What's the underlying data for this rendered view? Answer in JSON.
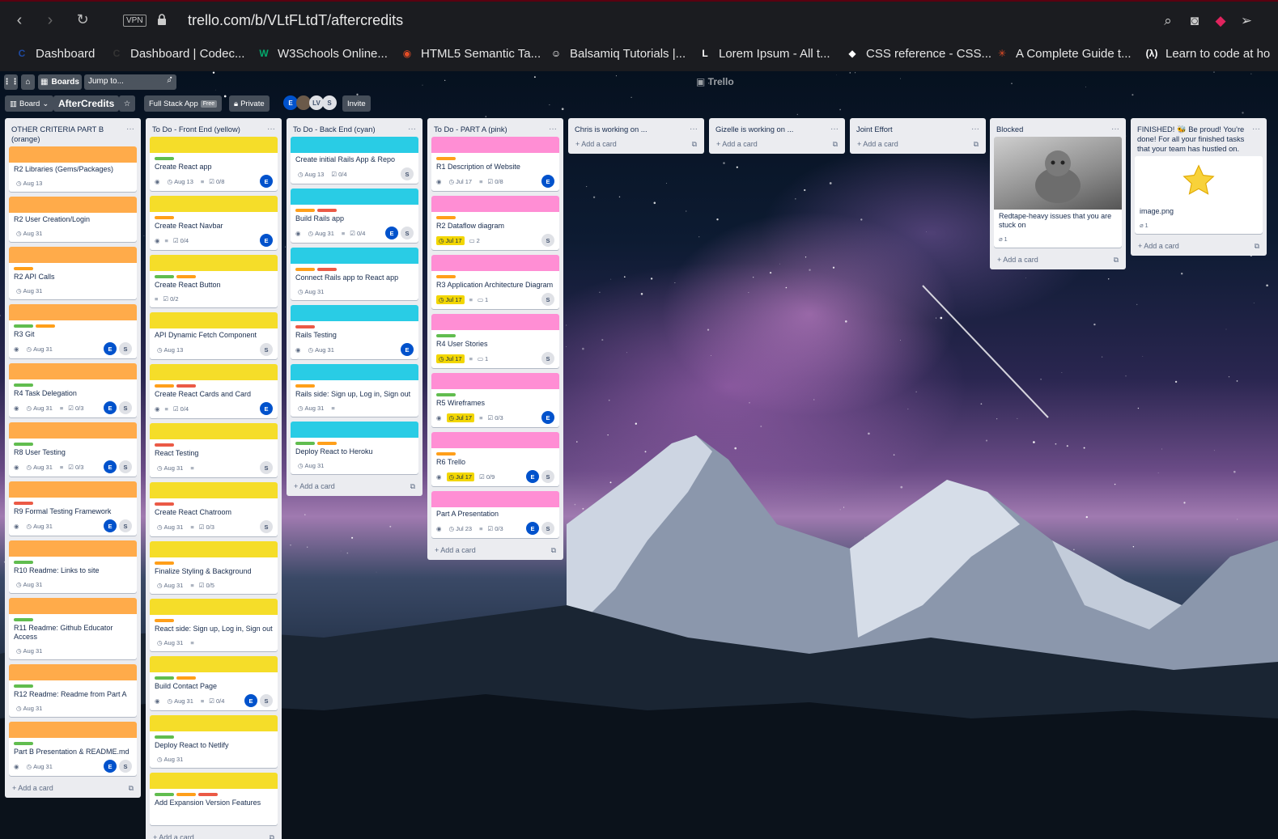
{
  "browser": {
    "url": "trello.com/b/VLtFLtdT/aftercredits",
    "vpn": "VPN"
  },
  "bookmarks": [
    {
      "label": "Dashboard",
      "icon": "codecademy-icon",
      "color": "#1f4aa0"
    },
    {
      "label": "Dashboard | Codec...",
      "icon": "codecademy-icon",
      "color": "#333"
    },
    {
      "label": "W3Schools Online...",
      "icon": "w3schools-icon",
      "color": "#04aa6d"
    },
    {
      "label": "HTML5 Semantic Ta...",
      "icon": "html-icon",
      "color": "#e44d26"
    },
    {
      "label": "Balsamiq Tutorials |...",
      "icon": "balsamiq-icon",
      "color": "#ffffff"
    },
    {
      "label": "Lorem Ipsum - All t...",
      "icon": "lorem-icon",
      "color": "#ffffff"
    },
    {
      "label": "CSS reference - CSS...",
      "icon": "css-icon",
      "color": "#ffffff"
    },
    {
      "label": "A Complete Guide t...",
      "icon": "csstricks-icon",
      "color": "#e44d26"
    },
    {
      "label": "Learn to code at ho",
      "icon": "freecodecamp-icon",
      "color": "#ffffff"
    }
  ],
  "topbar": {
    "boards": "Boards",
    "jump": "Jump to...",
    "logo": "Trello"
  },
  "header": {
    "board_btn": "Board",
    "title": "AfterCredits",
    "team": "Full Stack App",
    "team_badge": "Free",
    "privacy": "Private",
    "invite": "Invite",
    "members": [
      "E",
      "LV",
      "S"
    ]
  },
  "colors": {
    "orange": "#ffab4a",
    "yellow": "#f5dd29",
    "cyan": "#29cce5",
    "pink": "#ff8ed4",
    "green": "#61bd4f",
    "red": "#eb5a46",
    "lorange": "#ff9f1a"
  },
  "lists": [
    {
      "title": "OTHER CRITERIA PART B (orange)",
      "cover": "orange",
      "cards": [
        {
          "title": "R2 Libraries (Gems/Packages)",
          "labels": [],
          "watch": false,
          "due": "Aug 13"
        },
        {
          "title": "R2 User Creation/Login",
          "labels": [],
          "watch": false,
          "due": "Aug 31"
        },
        {
          "title": "R2 API Calls",
          "labels": [
            "lorange"
          ],
          "watch": false,
          "due": "Aug 31"
        },
        {
          "title": "R3 Git",
          "labels": [
            "green",
            "lorange"
          ],
          "watch": true,
          "due": "Aug 31",
          "avatars": [
            "E",
            "S"
          ]
        },
        {
          "title": "R4 Task Delegation",
          "labels": [
            "green"
          ],
          "watch": true,
          "due": "Aug 31",
          "desc": true,
          "check": "0/3",
          "avatars": [
            "E",
            "S"
          ]
        },
        {
          "title": "R8 User Testing",
          "labels": [
            "green"
          ],
          "watch": true,
          "due": "Aug 31",
          "desc": true,
          "check": "0/3",
          "avatars": [
            "E",
            "S"
          ]
        },
        {
          "title": "R9 Formal Testing Framework",
          "labels": [
            "red"
          ],
          "watch": true,
          "due": "Aug 31",
          "avatars": [
            "E",
            "S"
          ]
        },
        {
          "title": "R10 Readme: Links to site",
          "labels": [
            "green"
          ],
          "watch": false,
          "due": "Aug 31"
        },
        {
          "title": "R11 Readme: Github Educator Access",
          "labels": [
            "green"
          ],
          "watch": false,
          "due": "Aug 31"
        },
        {
          "title": "R12 Readme: Readme from Part A",
          "labels": [
            "green"
          ],
          "watch": false,
          "due": "Aug 31"
        },
        {
          "title": "Part B Presentation & README.md",
          "labels": [
            "green"
          ],
          "watch": true,
          "due": "Aug 31",
          "avatars": [
            "E",
            "S"
          ]
        }
      ],
      "add": "Add a card"
    },
    {
      "title": "To Do - Front End (yellow)",
      "cover": "yellow",
      "cards": [
        {
          "title": "Create React app",
          "labels": [
            "green"
          ],
          "watch": true,
          "due": "Aug 13",
          "desc": true,
          "check": "0/8",
          "avatars": [
            "E"
          ]
        },
        {
          "title": "Create React Navbar",
          "labels": [
            "lorange"
          ],
          "watch": true,
          "desc": true,
          "check": "0/4",
          "avatars": [
            "E"
          ]
        },
        {
          "title": "Create React Button",
          "labels": [
            "green",
            "lorange"
          ],
          "desc": true,
          "check": "0/2"
        },
        {
          "title": "API Dynamic Fetch Component",
          "labels": [],
          "due": "Aug 13",
          "avatars": [
            "S"
          ]
        },
        {
          "title": "Create React Cards and Card",
          "labels": [
            "lorange",
            "red"
          ],
          "watch": true,
          "desc": true,
          "check": "0/4",
          "avatars": [
            "E"
          ]
        },
        {
          "title": "React Testing",
          "labels": [
            "red"
          ],
          "due": "Aug 31",
          "desc": true,
          "avatars": [
            "S"
          ]
        },
        {
          "title": "Create React Chatroom",
          "labels": [
            "red"
          ],
          "due": "Aug 31",
          "desc": true,
          "check": "0/3",
          "avatars": [
            "S"
          ]
        },
        {
          "title": "Finalize Styling & Background",
          "labels": [
            "lorange"
          ],
          "due": "Aug 31",
          "desc": true,
          "check": "0/5"
        },
        {
          "title": "React side: Sign up, Log in, Sign out",
          "labels": [
            "lorange"
          ],
          "due": "Aug 31",
          "desc": true
        },
        {
          "title": "Build Contact Page",
          "labels": [
            "green",
            "lorange"
          ],
          "watch": true,
          "due": "Aug 31",
          "desc": true,
          "check": "0/4",
          "avatars": [
            "E",
            "S"
          ]
        },
        {
          "title": "Deploy React to Netlify",
          "labels": [
            "green"
          ],
          "due": "Aug 31"
        },
        {
          "title": "Add Expansion Version Features",
          "labels": [
            "green",
            "lorange",
            "red"
          ]
        }
      ],
      "add": "Add a card"
    },
    {
      "title": "To Do - Back End (cyan)",
      "cover": "cyan",
      "cards": [
        {
          "title": "Create initial Rails App & Repo",
          "labels": [],
          "due": "Aug 13",
          "check": "0/4",
          "avatars": [
            "S"
          ]
        },
        {
          "title": "Build Rails app",
          "labels": [
            "lorange",
            "red"
          ],
          "watch": true,
          "due": "Aug 31",
          "desc": true,
          "check": "0/4",
          "avatars": [
            "E",
            "S"
          ]
        },
        {
          "title": "Connect Rails app to React app",
          "labels": [
            "lorange",
            "red"
          ],
          "due": "Aug 31"
        },
        {
          "title": "Rails Testing",
          "labels": [
            "red"
          ],
          "watch": true,
          "due": "Aug 31",
          "avatars": [
            "E"
          ]
        },
        {
          "title": "Rails side: Sign up, Log in, Sign out",
          "labels": [
            "lorange"
          ],
          "due": "Aug 31",
          "desc": true
        },
        {
          "title": "Deploy React to Heroku",
          "labels": [
            "green",
            "lorange"
          ],
          "due": "Aug 31"
        }
      ],
      "add": "Add a card"
    },
    {
      "title": "To Do - PART A (pink)",
      "cover": "pink",
      "cards": [
        {
          "title": "R1 Description of Website",
          "labels": [
            "lorange"
          ],
          "watch": true,
          "due": "Jul 17",
          "desc": true,
          "check": "0/8",
          "avatars": [
            "E"
          ]
        },
        {
          "title": "R2 Dataflow diagram",
          "labels": [
            "lorange"
          ],
          "due": "Jul 17",
          "warn": true,
          "comments": "2",
          "avatars": [
            "S"
          ]
        },
        {
          "title": "R3 Application Architecture Diagram",
          "labels": [
            "lorange"
          ],
          "due": "Jul 17",
          "warn": true,
          "desc": true,
          "comments": "1",
          "avatars": [
            "S"
          ]
        },
        {
          "title": "R4 User Stories",
          "labels": [
            "green"
          ],
          "due": "Jul 17",
          "warn": true,
          "desc": true,
          "comments": "1",
          "avatars": [
            "S"
          ]
        },
        {
          "title": "R5 Wireframes",
          "labels": [
            "green"
          ],
          "watch": true,
          "due": "Jul 17",
          "warn": true,
          "desc": true,
          "check": "0/3",
          "avatars": [
            "E"
          ]
        },
        {
          "title": "R6 Trello",
          "labels": [
            "lorange"
          ],
          "watch": true,
          "due": "Jul 17",
          "warn": true,
          "check": "0/9",
          "avatars": [
            "E",
            "S"
          ]
        },
        {
          "title": "Part A Presentation",
          "labels": [],
          "watch": true,
          "due": "Jul 23",
          "desc": true,
          "check": "0/3",
          "avatars": [
            "E",
            "S"
          ]
        }
      ],
      "add": "Add a card"
    },
    {
      "title": "Chris is working on ...",
      "cards": [],
      "add": "Add a card"
    },
    {
      "title": "Gizelle is working on ...",
      "cards": [],
      "add": "Add a card"
    },
    {
      "title": "Joint Effort",
      "cards": [],
      "add": "Add a card"
    },
    {
      "title": "Blocked",
      "cards": [
        {
          "title": "Redtape-heavy issues that you are stuck on",
          "image": "cat-photo",
          "attach": "1"
        }
      ],
      "add": "Add a card"
    },
    {
      "title": "FINISHED! 🐝 Be proud! You're done! For all your finished tasks that your team has hustled on.",
      "cards": [
        {
          "title": "image.png",
          "image": "star-image",
          "attach": "1"
        }
      ],
      "add": "Add a card"
    }
  ]
}
